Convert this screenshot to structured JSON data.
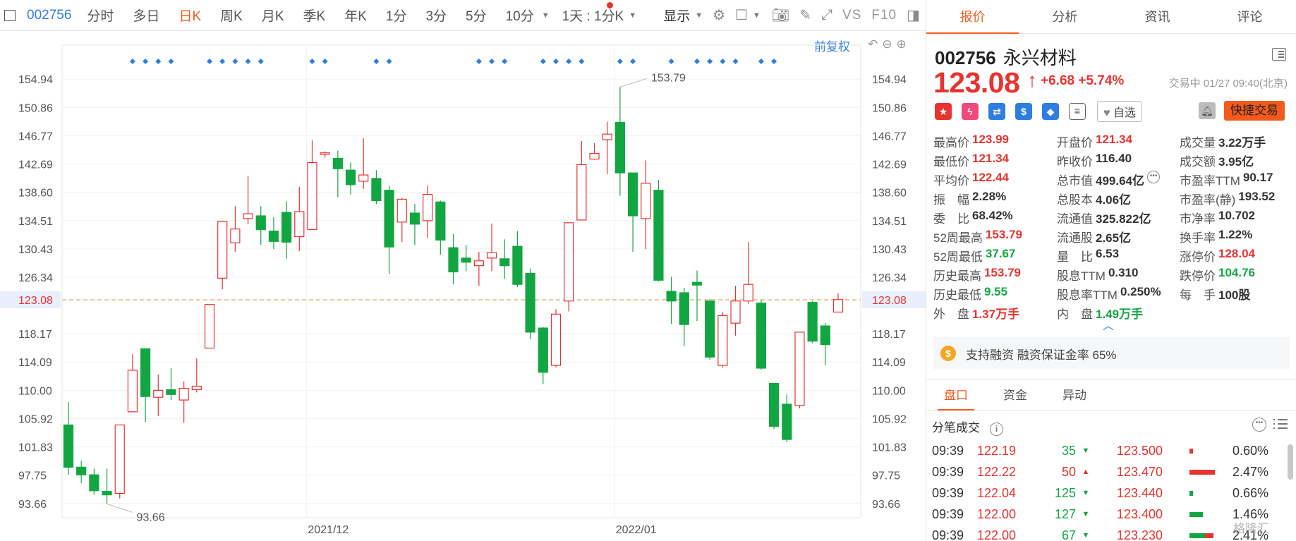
{
  "toolbar": {
    "code": "002756",
    "tabs": [
      "分时",
      "多日",
      "日K",
      "周K",
      "月K",
      "季K",
      "年K",
      "1分",
      "3分",
      "5分",
      "10分"
    ],
    "active_tab": "日K",
    "period_select": "1天 : 1分K",
    "display_label": "显示",
    "vs_label": "VS",
    "f10_label": "F10"
  },
  "chart": {
    "adjust_label": "前复权",
    "last_price_label": "123.08",
    "high_annot": "153.79",
    "low_annot": "93.66",
    "dates": [
      "2021/12",
      "2022/01"
    ]
  },
  "chart_data": {
    "type": "candlestick",
    "ylim": [
      91.6,
      157.0
    ],
    "yticks": [
      "154.94",
      "150.86",
      "146.77",
      "142.69",
      "138.60",
      "134.51",
      "130.43",
      "126.34",
      "118.17",
      "114.09",
      "110.00",
      "105.92",
      "101.83",
      "97.75",
      "93.66"
    ],
    "reference_line": 123.08,
    "highlight_high": 153.79,
    "highlight_low": 93.66,
    "candles": [
      {
        "o": 105.0,
        "c": 98.9,
        "h": 108.3,
        "l": 97.8
      },
      {
        "o": 98.9,
        "c": 97.8,
        "h": 99.8,
        "l": 96.6
      },
      {
        "o": 97.8,
        "c": 95.5,
        "h": 98.7,
        "l": 94.9
      },
      {
        "o": 95.4,
        "c": 94.9,
        "h": 98.7,
        "l": 93.6
      },
      {
        "o": 95.1,
        "c": 105.0,
        "h": 105.0,
        "l": 94.4
      },
      {
        "o": 106.9,
        "c": 112.9,
        "h": 115.2,
        "l": 106.9
      },
      {
        "o": 116.0,
        "c": 109.1,
        "h": 116.0,
        "l": 105.4
      },
      {
        "o": 109.0,
        "c": 110.0,
        "h": 112.3,
        "l": 106.3
      },
      {
        "o": 110.1,
        "c": 109.4,
        "h": 113.2,
        "l": 108.6
      },
      {
        "o": 108.6,
        "c": 110.3,
        "h": 111.3,
        "l": 105.3
      },
      {
        "o": 110.1,
        "c": 110.6,
        "h": 114.6,
        "l": 109.7
      },
      {
        "o": 116.1,
        "c": 122.4,
        "h": 122.4,
        "l": 116.1
      },
      {
        "o": 126.2,
        "c": 134.4,
        "h": 134.4,
        "l": 124.6
      },
      {
        "o": 131.3,
        "c": 133.3,
        "h": 136.6,
        "l": 130.0
      },
      {
        "o": 134.8,
        "c": 135.5,
        "h": 141.0,
        "l": 134.0
      },
      {
        "o": 135.2,
        "c": 133.2,
        "h": 136.6,
        "l": 131.0
      },
      {
        "o": 133.0,
        "c": 131.5,
        "h": 135.0,
        "l": 130.4
      },
      {
        "o": 135.7,
        "c": 131.4,
        "h": 137.3,
        "l": 129.0
      },
      {
        "o": 132.2,
        "c": 135.8,
        "h": 139.4,
        "l": 130.1
      },
      {
        "o": 133.2,
        "c": 142.9,
        "h": 146.1,
        "l": 133.2
      },
      {
        "o": 144.1,
        "c": 144.3,
        "h": 144.5,
        "l": 143.6
      },
      {
        "o": 143.5,
        "c": 142.0,
        "h": 144.6,
        "l": 137.9
      },
      {
        "o": 141.8,
        "c": 139.7,
        "h": 142.9,
        "l": 138.3
      },
      {
        "o": 140.2,
        "c": 141.1,
        "h": 146.4,
        "l": 139.1
      },
      {
        "o": 140.6,
        "c": 137.4,
        "h": 141.8,
        "l": 136.9
      },
      {
        "o": 138.9,
        "c": 130.7,
        "h": 139.6,
        "l": 126.8
      },
      {
        "o": 134.3,
        "c": 137.6,
        "h": 137.8,
        "l": 131.4
      },
      {
        "o": 135.6,
        "c": 134.0,
        "h": 136.9,
        "l": 131.0
      },
      {
        "o": 134.5,
        "c": 138.3,
        "h": 139.6,
        "l": 132.0
      },
      {
        "o": 137.2,
        "c": 131.7,
        "h": 137.4,
        "l": 129.6
      },
      {
        "o": 130.6,
        "c": 127.1,
        "h": 132.6,
        "l": 125.3
      },
      {
        "o": 129.1,
        "c": 128.5,
        "h": 131.0,
        "l": 127.2
      },
      {
        "o": 128.0,
        "c": 128.7,
        "h": 130.0,
        "l": 125.1
      },
      {
        "o": 129.1,
        "c": 129.9,
        "h": 134.1,
        "l": 127.2
      },
      {
        "o": 129.0,
        "c": 128.0,
        "h": 131.8,
        "l": 126.1
      },
      {
        "o": 130.8,
        "c": 125.3,
        "h": 133.0,
        "l": 124.9
      },
      {
        "o": 126.9,
        "c": 118.4,
        "h": 127.6,
        "l": 117.4
      },
      {
        "o": 119.0,
        "c": 112.6,
        "h": 119.1,
        "l": 110.9
      },
      {
        "o": 113.6,
        "c": 121.0,
        "h": 121.7,
        "l": 113.3
      },
      {
        "o": 122.9,
        "c": 134.2,
        "h": 134.2,
        "l": 121.4
      },
      {
        "o": 134.6,
        "c": 142.6,
        "h": 146.0,
        "l": 134.6
      },
      {
        "o": 143.4,
        "c": 144.2,
        "h": 145.7,
        "l": 143.3
      },
      {
        "o": 146.2,
        "c": 147.0,
        "h": 148.8,
        "l": 141.2
      },
      {
        "o": 148.7,
        "c": 141.4,
        "h": 153.8,
        "l": 138.1
      },
      {
        "o": 141.4,
        "c": 135.2,
        "h": 141.4,
        "l": 130.0
      },
      {
        "o": 134.8,
        "c": 139.9,
        "h": 143.2,
        "l": 130.4
      },
      {
        "o": 138.9,
        "c": 125.9,
        "h": 140.4,
        "l": 125.7
      },
      {
        "o": 124.3,
        "c": 122.9,
        "h": 126.4,
        "l": 119.6
      },
      {
        "o": 124.1,
        "c": 119.5,
        "h": 124.8,
        "l": 116.4
      },
      {
        "o": 125.6,
        "c": 125.2,
        "h": 127.3,
        "l": 120.0
      },
      {
        "o": 122.9,
        "c": 114.8,
        "h": 123.2,
        "l": 114.4
      },
      {
        "o": 113.6,
        "c": 120.8,
        "h": 121.3,
        "l": 113.3
      },
      {
        "o": 119.7,
        "c": 122.9,
        "h": 125.1,
        "l": 117.9
      },
      {
        "o": 122.9,
        "c": 125.3,
        "h": 131.4,
        "l": 122.5
      },
      {
        "o": 122.6,
        "c": 113.2,
        "h": 123.1,
        "l": 113.0
      },
      {
        "o": 111.0,
        "c": 104.8,
        "h": 111.0,
        "l": 104.4
      },
      {
        "o": 108.0,
        "c": 102.9,
        "h": 109.4,
        "l": 102.5
      },
      {
        "o": 107.8,
        "c": 118.4,
        "h": 118.4,
        "l": 107.4
      },
      {
        "o": 122.7,
        "c": 117.1,
        "h": 122.9,
        "l": 116.8
      },
      {
        "o": 119.3,
        "c": 116.6,
        "h": 119.7,
        "l": 113.6
      },
      {
        "o": 121.3,
        "c": 123.1,
        "h": 124.0,
        "l": 121.3
      }
    ],
    "markers_at": [
      5,
      6,
      7,
      8,
      11,
      12,
      13,
      14,
      15,
      19,
      20,
      24,
      25,
      32,
      33,
      34,
      37,
      38,
      39,
      40,
      43,
      44,
      47,
      49,
      50,
      51,
      52,
      54,
      55
    ]
  },
  "quote": {
    "tabs": [
      "报价",
      "分析",
      "资讯",
      "评论"
    ],
    "active_tab": "报价",
    "code": "002756",
    "name": "永兴材料",
    "price": "123.08",
    "arrow": "↑",
    "change": "+6.68",
    "change_pct": "+5.74%",
    "trade_status": "交易中 01/27 09:40(北京)",
    "icons": [
      "flag-icon",
      "flash-icon",
      "shuffle-icon",
      "dollar-icon",
      "tag-icon",
      "note-icon"
    ],
    "watch_label": "自选",
    "quick_trade_label": "快捷交易",
    "stats": [
      [
        {
          "k": "最高价",
          "v": "123.99",
          "c": "red"
        },
        {
          "k": "开盘价",
          "v": "121.34",
          "c": "red"
        },
        {
          "k": "成交量",
          "v": "3.22万手",
          "c": ""
        }
      ],
      [
        {
          "k": "最低价",
          "v": "121.34",
          "c": "red"
        },
        {
          "k": "昨收价",
          "v": "116.40",
          "c": ""
        },
        {
          "k": "成交额",
          "v": "3.95亿",
          "c": ""
        }
      ],
      [
        {
          "k": "平均价",
          "v": "122.44",
          "c": "red"
        },
        {
          "k": "总市值",
          "v": "499.64亿",
          "c": ""
        },
        {
          "k": "市盈率TTM",
          "v": "90.17",
          "c": ""
        }
      ],
      [
        {
          "k": "振　幅",
          "v": "2.28%",
          "c": ""
        },
        {
          "k": "总股本",
          "v": "4.06亿",
          "c": ""
        },
        {
          "k": "市盈率(静)",
          "v": "193.52",
          "c": ""
        }
      ],
      [
        {
          "k": "委　比",
          "v": "68.42%",
          "c": ""
        },
        {
          "k": "流通值",
          "v": "325.822亿",
          "c": ""
        },
        {
          "k": "市净率",
          "v": "10.702",
          "c": ""
        }
      ],
      [
        {
          "k": "52周最高",
          "v": "153.79",
          "c": "red"
        },
        {
          "k": "流通股",
          "v": "2.65亿",
          "c": ""
        },
        {
          "k": "换手率",
          "v": "1.22%",
          "c": ""
        }
      ],
      [
        {
          "k": "52周最低",
          "v": "37.67",
          "c": "green"
        },
        {
          "k": "量　比",
          "v": "6.53",
          "c": ""
        },
        {
          "k": "涨停价",
          "v": "128.04",
          "c": "red"
        }
      ],
      [
        {
          "k": "历史最高",
          "v": "153.79",
          "c": "red"
        },
        {
          "k": "股息TTM",
          "v": "0.310",
          "c": ""
        },
        {
          "k": "跌停价",
          "v": "104.76",
          "c": "green"
        }
      ],
      [
        {
          "k": "历史最低",
          "v": "9.55",
          "c": "green"
        },
        {
          "k": "股息率TTM",
          "v": "0.250%",
          "c": ""
        },
        {
          "k": "每　手",
          "v": "100股",
          "c": ""
        }
      ],
      [
        {
          "k": "外　盘",
          "v": "1.37万手",
          "c": "red"
        },
        {
          "k": "内　盘",
          "v": "1.49万手",
          "c": "green"
        },
        {
          "k": "",
          "v": "",
          "c": ""
        }
      ]
    ],
    "margin_text": "支持融资 融资保证金率 65%",
    "sub_tabs": [
      "盘口",
      "资金",
      "异动"
    ],
    "sub_active": "盘口",
    "tick_title": "分笔成交",
    "ticks": [
      {
        "time": "09:39",
        "price": "122.19",
        "vol": "35",
        "dir": "down",
        "bp": "123.500",
        "bar": 0.12,
        "barc": "#e8332f",
        "pct": "0.60%"
      },
      {
        "time": "09:39",
        "price": "122.22",
        "vol": "50",
        "dir": "up",
        "bp": "123.470",
        "bar": 0.95,
        "barc": "#e8332f",
        "pct": "2.47%"
      },
      {
        "time": "09:39",
        "price": "122.04",
        "vol": "125",
        "dir": "down",
        "bp": "123.440",
        "bar": 0.12,
        "barc": "#12a642",
        "pct": "0.66%"
      },
      {
        "time": "09:39",
        "price": "122.00",
        "vol": "127",
        "dir": "down",
        "bp": "123.400",
        "bar": 0.5,
        "barc": "#12a642",
        "pct": "1.46%"
      },
      {
        "time": "09:39",
        "price": "122.00",
        "vol": "67",
        "dir": "down",
        "bp": "123.230",
        "bar": 0.9,
        "barc": "#12a642",
        "pct": "2.41%"
      }
    ]
  },
  "colors": {
    "up": "#e8332f",
    "down": "#12a642",
    "accent": "#f45a1b",
    "link": "#2f7de1"
  },
  "watermark": "格隆汇"
}
